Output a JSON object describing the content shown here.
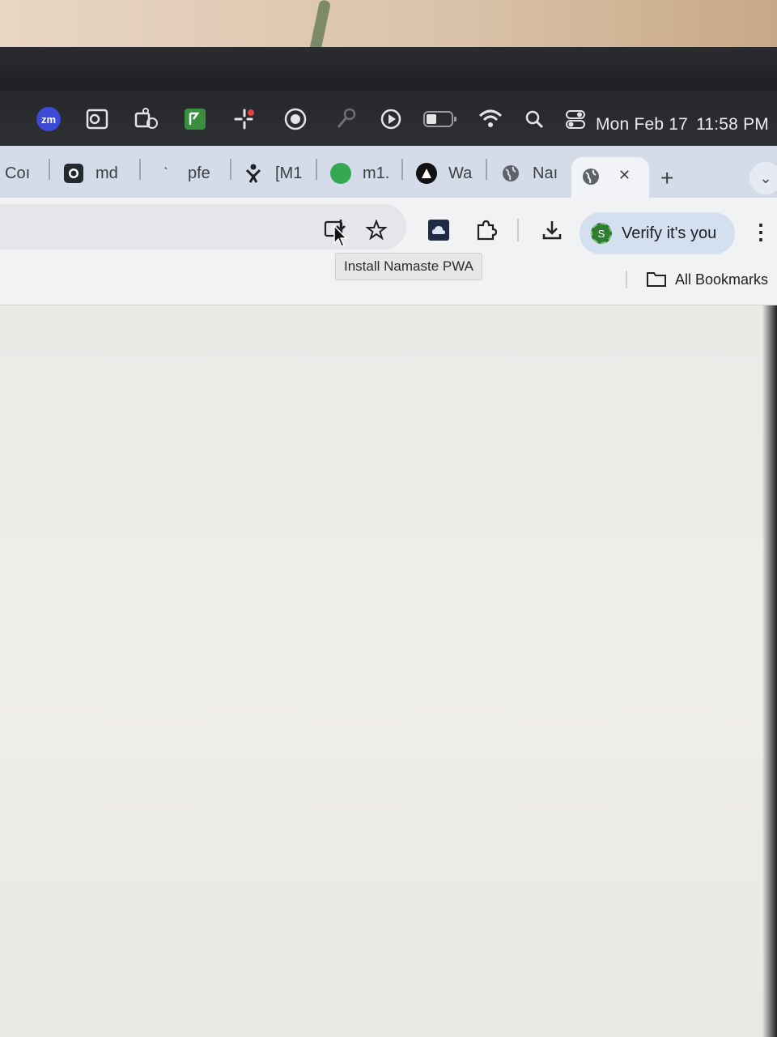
{
  "menubar": {
    "icons": [
      "zoom-icon",
      "outlook-icon",
      "teams-icon",
      "green-app-icon",
      "pinwheel-icon",
      "aperture-icon",
      "key-icon",
      "play-icon",
      "battery-icon",
      "wifi-icon",
      "search-icon",
      "control-center-icon"
    ],
    "zoom_label": "zm",
    "date": "Mon Feb 17",
    "time": "11:58 PM"
  },
  "tabs": [
    {
      "label": "Coı",
      "icon": null
    },
    {
      "label": "md",
      "icon": "github-icon"
    },
    {
      "label": "pfe",
      "icon": "tick-icon"
    },
    {
      "label": "[M1",
      "icon": "confluence-icon"
    },
    {
      "label": "m1.",
      "icon": "green-circle-icon"
    },
    {
      "label": "Wa",
      "icon": "triangle-icon"
    },
    {
      "label": "Naı",
      "icon": "globe-icon"
    }
  ],
  "active_tab": {
    "icon": "globe-icon",
    "close": "✕"
  },
  "new_tab": "+",
  "tab_menu": "⌄",
  "toolbar": {
    "tooltip": "Install Namaste PWA",
    "verify_label": "Verify it's you",
    "avatar_letter": "S",
    "more": "⋮"
  },
  "bookmarks": {
    "all_label": "All Bookmarks"
  },
  "colors": {
    "menubar": "#2a2b2f",
    "tabstrip": "#d4dcea",
    "verify_bg": "#d4dff0",
    "avatar": "#2e7d32"
  }
}
